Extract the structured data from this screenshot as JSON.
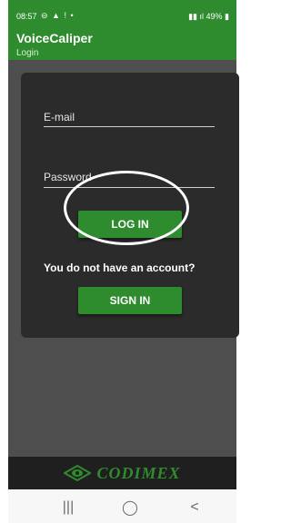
{
  "status_bar": {
    "time": "08:57",
    "left_icons": "⊖ ▲ ! •",
    "battery": "49%"
  },
  "app": {
    "title": "VoiceCaliper",
    "subtitle": "Login"
  },
  "form": {
    "email_label": "E-mail",
    "password_label": "Password",
    "login_button": "LOG IN",
    "no_account_text": "You do not have an account?",
    "signin_button": "SIGN IN"
  },
  "footer": {
    "brand": "CODIMEX"
  },
  "nav": {
    "recent": "|||",
    "home": "◯",
    "back": "<"
  }
}
